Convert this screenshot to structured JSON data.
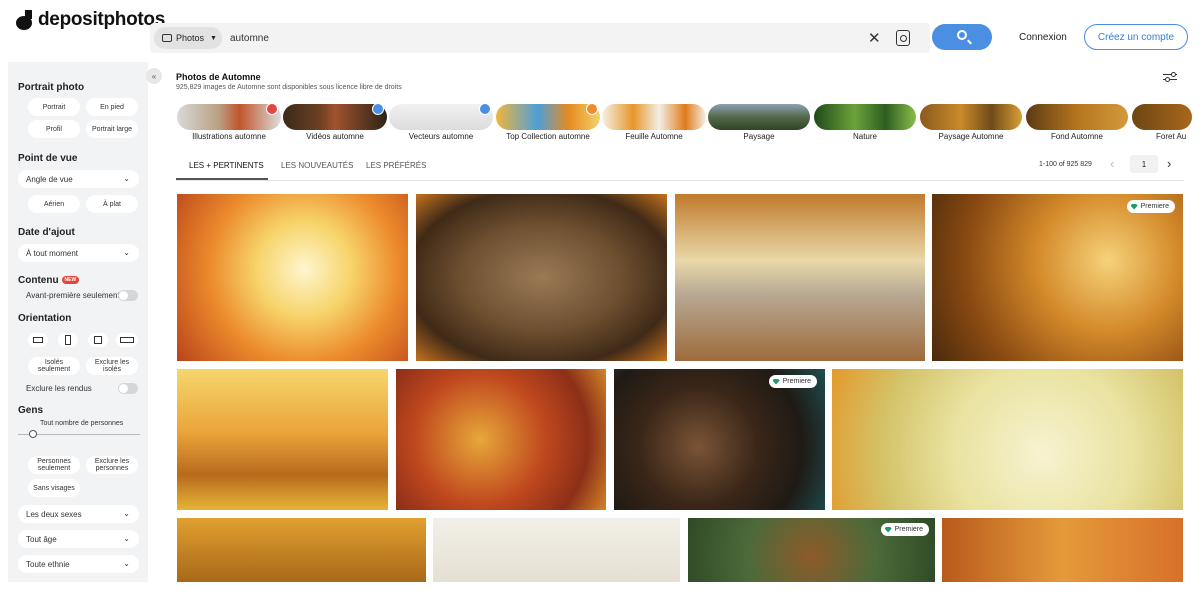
{
  "header": {
    "logo_text": "depositphotos",
    "type_select": "Photos",
    "search_value": "automne",
    "login": "Connexion",
    "signup": "Créez un compte"
  },
  "sidebar": {
    "portrait_heading": "Portrait photo",
    "portrait_options": [
      "Portrait",
      "En pied",
      "Profil",
      "Portrait large"
    ],
    "pov_heading": "Point de vue",
    "pov_select": "Angle de vue",
    "pov_options": [
      "Aérien",
      "À plat"
    ],
    "date_heading": "Date d'ajout",
    "date_select": "À tout moment",
    "content_heading": "Contenu",
    "content_badge": "NEW",
    "preview_only": "Avant-première seulement",
    "orientation_heading": "Orientation",
    "isolated_only": "Isolés seulement",
    "exclude_isolated": "Exclure les isolés",
    "exclude_renders": "Exclure les rendus",
    "people_heading": "Gens",
    "people_count": "Tout nombre de personnes",
    "people_only": "Personnes seulement",
    "exclude_people": "Exclure les personnes",
    "no_faces": "Sans visages",
    "gender_select": "Les deux sexes",
    "age_select": "Tout âge",
    "ethnicity_select": "Toute ethnie"
  },
  "main": {
    "title": "Photos de Automne",
    "subtitle": "925,829 images de Automne sont disponibles sous licence libre de droits",
    "categories": [
      "Illustrations automne",
      "Vidéos automne",
      "Vecteurs automne",
      "Top Collection automne",
      "Feuille Automne",
      "Paysage",
      "Nature",
      "Paysage Automne",
      "Fond Automne",
      "Foret Au"
    ],
    "tabs": [
      "LES + PERTINENTS",
      "LES NOUVEAUTÉS",
      "LES PRÉFÉRÉS"
    ],
    "pager_range": "1-100 of 925 829",
    "pager_page": "1",
    "premiere_label": "Premiere"
  },
  "colors": {
    "accent": "#4b8fe2",
    "premiere_gem": "#1c9c6c",
    "new_badge": "#e2473d"
  }
}
